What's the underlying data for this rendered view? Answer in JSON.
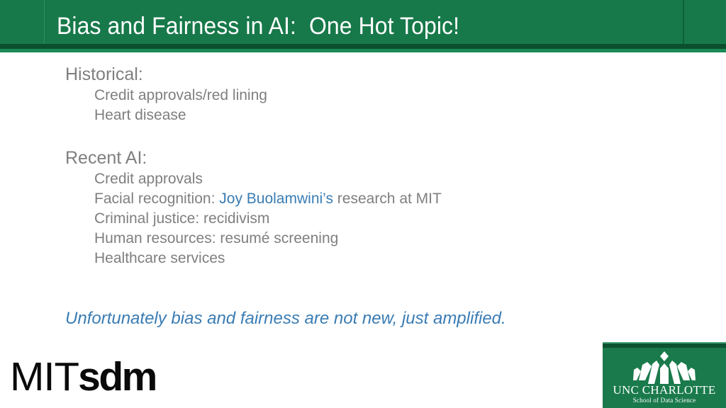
{
  "slide": {
    "title": "Bias and Fairness in AI:  One Hot Topic!",
    "header_color": "#17794A",
    "header_stripe_dark": "#0B4F2E",
    "header_stripe_mid": "#1C8A56",
    "body_text_color": "#7F7F7F",
    "accent_blue": "#3A7CB3",
    "background_color": "#FFFFFF"
  },
  "content": {
    "sections": [
      {
        "heading": "Historical:",
        "items": [
          {
            "prefix": "Credit approvals/red lining",
            "link": "",
            "suffix": ""
          },
          {
            "prefix": "Heart disease",
            "link": "",
            "suffix": ""
          }
        ]
      },
      {
        "heading": "Recent AI:",
        "items": [
          {
            "prefix": "Credit approvals",
            "link": "",
            "suffix": ""
          },
          {
            "prefix": "Facial recognition: ",
            "link": "Joy Buolamwini’s",
            "suffix": " research at MIT"
          },
          {
            "prefix": "Criminal justice: recidivism",
            "link": "",
            "suffix": ""
          },
          {
            "prefix": "Human resources: resumé screening",
            "link": "",
            "suffix": ""
          },
          {
            "prefix": "Healthcare services",
            "link": "",
            "suffix": ""
          }
        ]
      }
    ],
    "closing": "Unfortunately bias and fairness are not new, just amplified."
  },
  "logos": {
    "mit": {
      "light_part": "MIT",
      "bold_part": "sdm"
    },
    "unc": {
      "name": "UNC CHARLOTTE",
      "subtitle": "School of Data Science",
      "background_color": "#1A7A4C"
    }
  }
}
